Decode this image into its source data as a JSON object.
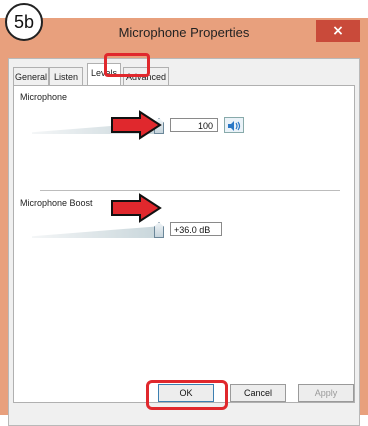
{
  "step": "5b",
  "window": {
    "title": "Microphone Properties",
    "close_label": "×"
  },
  "tabs": [
    {
      "label": "General",
      "active": false
    },
    {
      "label": "Listen",
      "active": false
    },
    {
      "label": "Levels",
      "active": true
    },
    {
      "label": "Advanced",
      "active": false
    }
  ],
  "microphone": {
    "label": "Microphone",
    "value": "100",
    "level_fraction": 1.0
  },
  "boost": {
    "label": "Microphone Boost",
    "value": "+36.0 dB",
    "level_fraction": 1.0
  },
  "buttons": {
    "ok": "OK",
    "cancel": "Cancel",
    "apply": "Apply"
  },
  "colors": {
    "annotation_red": "#e0282d",
    "title_bar": "#e8a07d"
  }
}
